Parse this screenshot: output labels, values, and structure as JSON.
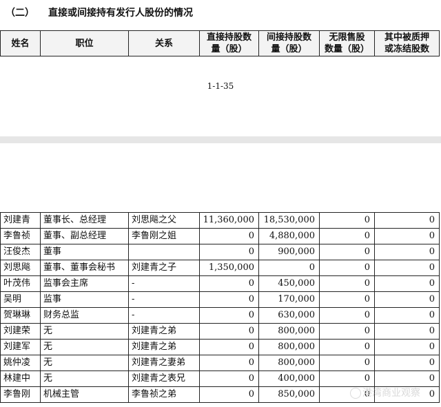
{
  "section": {
    "number": "（二）",
    "title": "直接或间接持有发行人股份的情况"
  },
  "headers": [
    "姓名",
    "职位",
    "关系",
    "直接持股数量（股）",
    "间接持股数量（股）",
    "无限售股数量（股）",
    "其中被质押或冻结股数"
  ],
  "header_lines": [
    [
      "姓名"
    ],
    [
      "职位"
    ],
    [
      "关系"
    ],
    [
      "直接持股数",
      "量（股）"
    ],
    [
      "间接持股数",
      "量（股）"
    ],
    [
      "无限售股",
      "数量（股）"
    ],
    [
      "其中被质押",
      "或冻结股数"
    ]
  ],
  "page_number": "1-1-35",
  "rows": [
    [
      "刘建青",
      "董事长、总经理",
      "刘思飚之父",
      "11,360,000",
      "18,530,000",
      "0",
      "0"
    ],
    [
      "李鲁祯",
      "董事、副总经理",
      "李鲁刚之姐",
      "0",
      "4,880,000",
      "0",
      "0"
    ],
    [
      "汪俊杰",
      "董事",
      "",
      "0",
      "900,000",
      "0",
      "0"
    ],
    [
      "刘思飚",
      "董事、董事会秘书",
      "刘建青之子",
      "1,350,000",
      "0",
      "0",
      "0"
    ],
    [
      "叶茂伟",
      "监事会主席",
      "-",
      "0",
      "450,000",
      "0",
      "0"
    ],
    [
      "吴明",
      "监事",
      "-",
      "0",
      "170,000",
      "0",
      "0"
    ],
    [
      "贺琳琳",
      "财务总监",
      "-",
      "0",
      "630,000",
      "0",
      "0"
    ],
    [
      "刘建荣",
      "无",
      "刘建青之弟",
      "0",
      "800,000",
      "0",
      "0"
    ],
    [
      "刘建军",
      "无",
      "刘建青之弟",
      "0",
      "800,000",
      "0",
      "0"
    ],
    [
      "姚仲凌",
      "无",
      "刘建青之妻弟",
      "0",
      "800,000",
      "0",
      "0"
    ],
    [
      "林建中",
      "无",
      "刘建青之表兄",
      "0",
      "400,000",
      "0",
      "0"
    ],
    [
      "李鲁刚",
      "机械主管",
      "李鲁祯之弟",
      "0",
      "850,000",
      "0",
      "0"
    ]
  ],
  "watermark": "港湾商业观察"
}
